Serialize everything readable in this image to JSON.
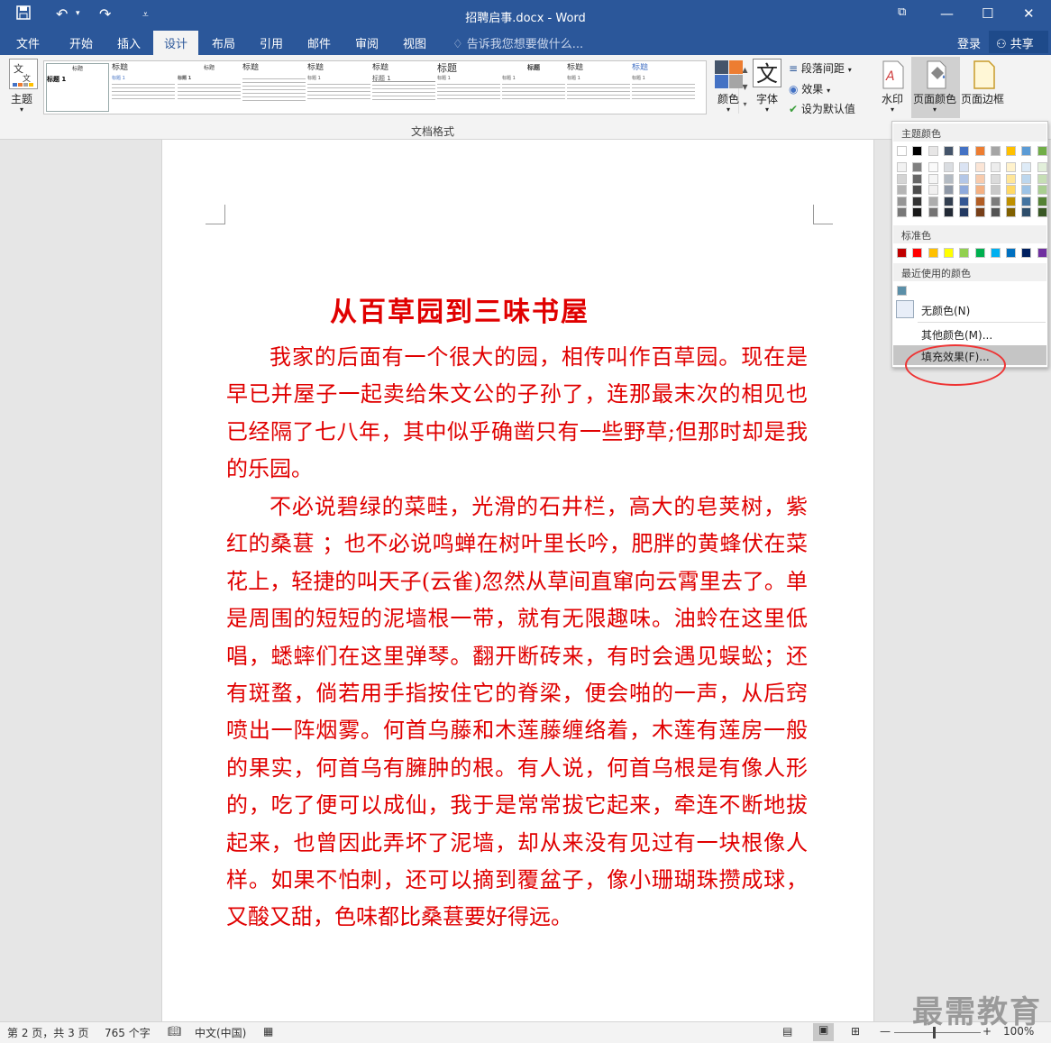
{
  "window": {
    "title": "招聘启事.docx - Word"
  },
  "tabs": [
    "文件",
    "开始",
    "插入",
    "设计",
    "布局",
    "引用",
    "邮件",
    "审阅",
    "视图"
  ],
  "tell_me": "告诉我您想要做什么...",
  "account": {
    "login": "登录",
    "share": "共享"
  },
  "ribbon": {
    "theme_label": "主题",
    "gallery_title": "标题",
    "gallery_heading1": "标题 1",
    "colors_label": "颜色",
    "fonts_label": "字体",
    "paragraph_spacing": "段落间距",
    "effects": "效果",
    "set_default": "设为默认值",
    "watermark_label": "水印",
    "page_color_label": "页面颜色",
    "page_borders_label": "页面边框",
    "group_label": "文档格式"
  },
  "color_menu": {
    "theme_colors_label": "主题颜色",
    "standard_colors_label": "标准色",
    "recent_colors_label": "最近使用的颜色",
    "no_color": "无颜色(N)",
    "more_colors": "其他颜色(M)...",
    "fill_effects": "填充效果(F)...",
    "theme_row": [
      "#ffffff",
      "#000000",
      "#e7e6e6",
      "#44546a",
      "#4472c4",
      "#ed7d31",
      "#a5a5a5",
      "#ffc000",
      "#5b9bd5",
      "#70ad47"
    ],
    "standard_row": [
      "#c00000",
      "#ff0000",
      "#ffc000",
      "#ffff00",
      "#92d050",
      "#00b050",
      "#00b0f0",
      "#0070c0",
      "#002060",
      "#7030a0"
    ],
    "recent": [
      "#5b8fa8"
    ]
  },
  "document": {
    "title": "从百草园到三味书屋",
    "para1": "我家的后面有一个很大的园，相传叫作百草园。现在是早已并屋子一起卖给朱文公的子孙了，连那最末次的相见也已经隔了七八年，其中似乎确凿只有一些野草;但那时却是我的乐园。",
    "para2": "不必说碧绿的菜畦，光滑的石井栏，高大的皂荚树，紫红的桑葚 ；也不必说鸣蝉在树叶里长吟，肥胖的黄蜂伏在菜花上，轻捷的叫天子(云雀)忽然从草间直窜向云霄里去了。单是周围的短短的泥墙根一带，就有无限趣味。油蛉在这里低唱，蟋蟀们在这里弹琴。翻开断砖来，有时会遇见蜈蚣；还有斑蝥，倘若用手指按住它的脊梁，便会啪的一声，从后窍喷出一阵烟雾。何首乌藤和木莲藤缠络着，木莲有莲房一般的果实，何首乌有臃肿的根。有人说，何首乌根是有像人形的，吃了便可以成仙，我于是常常拔它起来，牵连不断地拔起来，也曾因此弄坏了泥墙，却从来没有见过有一块根像人样。如果不怕刺，还可以摘到覆盆子，像小珊瑚珠攒成球，又酸又甜，色味都比桑葚要好得远。"
  },
  "status": {
    "page": "第 2 页，共 3 页",
    "words": "765 个字",
    "lang": "中文(中国)",
    "zoom": "100%"
  },
  "watermark_text": "最需教育"
}
